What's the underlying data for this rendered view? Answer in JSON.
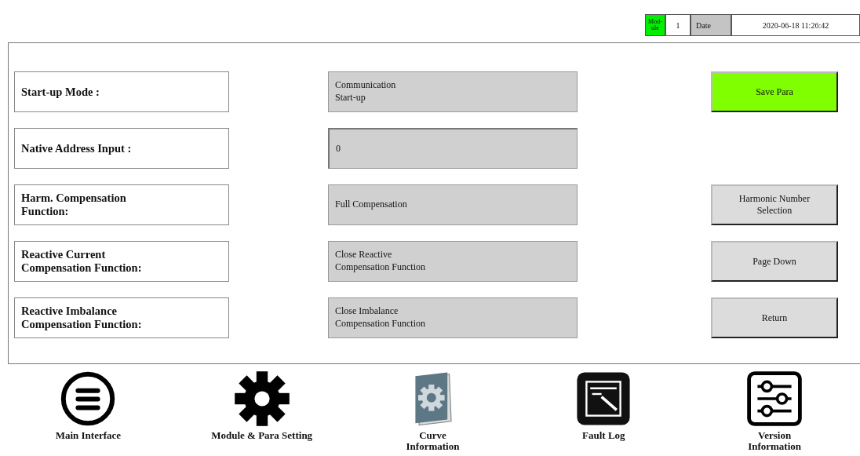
{
  "header": {
    "module_label": "Mod-\nule",
    "module_value": "1",
    "date_label": "Date",
    "date_value": "2020-06-18 11:26:42"
  },
  "params": [
    {
      "label": "Start-up Mode :",
      "value": "Communication\nStart-up",
      "kind": "display",
      "button": {
        "label": "Save Para",
        "kind": "primary"
      }
    },
    {
      "label": "Native Address Input :",
      "value": "0",
      "kind": "input"
    },
    {
      "label": "Harm. Compensation\nFunction:",
      "value": "Full Compensation",
      "kind": "display",
      "button": {
        "label": "Harmonic Number\nSelection",
        "kind": "normal"
      }
    },
    {
      "label": "Reactive Current\nCompensation Function:",
      "value": "Close Reactive\nCompensation Function",
      "kind": "display",
      "button": {
        "label": "Page Down",
        "kind": "normal"
      }
    },
    {
      "label": "Reactive Imbalance\nCompensation Function:",
      "value": "Close Imbalance\nCompensation Function",
      "kind": "display",
      "button": {
        "label": "Return",
        "kind": "normal"
      }
    }
  ],
  "nav": [
    {
      "label": "Main Interface",
      "kind": "menu"
    },
    {
      "label": "Module & Para Setting",
      "kind": "gear"
    },
    {
      "label": "Curve\nInformation",
      "kind": "notebook"
    },
    {
      "label": "Fault Log",
      "kind": "log"
    },
    {
      "label": "Version\nInformation",
      "kind": "sliders"
    }
  ]
}
